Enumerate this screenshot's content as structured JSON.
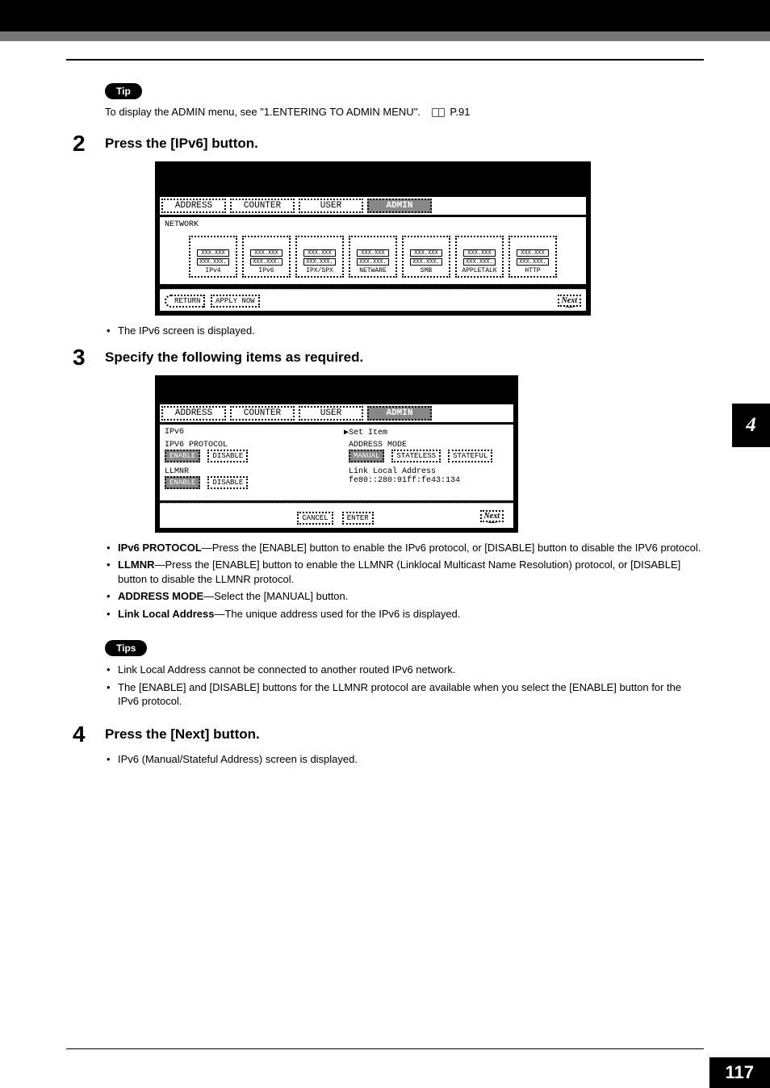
{
  "header": {},
  "tip1": {
    "label": "Tip",
    "text_a": "To display the ADMIN menu, see \"1.ENTERING TO ADMIN MENU\".",
    "page_ref": "P.91"
  },
  "step2": {
    "num": "2",
    "title": "Press the [IPv6] button.",
    "panel": {
      "tabs": [
        "ADDRESS",
        "COUNTER",
        "USER",
        "ADMIN"
      ],
      "active": "ADMIN",
      "heading": "NETWORK",
      "icons": [
        {
          "l1": "XXX.XXX",
          "l2": "XXX.XXX.",
          "label": "IPv4"
        },
        {
          "l1": "XXX.XXX",
          "l2": "XXX.XXX.",
          "label": "IPv6"
        },
        {
          "l1": "XXX.XXX",
          "l2": "XXX.XXX.",
          "label": "IPX/SPX"
        },
        {
          "l1": "XXX.XXX",
          "l2": "XXX.XXX.",
          "label": "NETWARE"
        },
        {
          "l1": "XXX.XXX",
          "l2": "XXX.XXX.",
          "label": "SMB"
        },
        {
          "l1": "XXX.XXX",
          "l2": "XXX.XXX.",
          "label": "APPLETALK"
        },
        {
          "l1": "XXX.XXX",
          "l2": "XXX.XXX.",
          "label": "HTTP"
        }
      ],
      "return": "RETURN",
      "apply": "APPLY NOW",
      "next": "Next"
    },
    "after_bullet": "The IPv6 screen is displayed."
  },
  "step3": {
    "num": "3",
    "title": "Specify the following items as required.",
    "panel": {
      "tabs": [
        "ADDRESS",
        "COUNTER",
        "USER",
        "ADMIN"
      ],
      "active": "ADMIN",
      "row1_left": "IPv6",
      "row1_right": "▶Set Item",
      "left_blocks": {
        "proto_label": "IPV6 PROTOCOL",
        "llmnr_label": "LLMNR",
        "enable": "ENABLE",
        "disable": "DISABLE"
      },
      "right_blocks": {
        "mode_label": "ADDRESS MODE",
        "manual": "MANUAL",
        "stateless": "STATELESS",
        "stateful": "STATEFUL",
        "link_label": "Link Local Address",
        "link_value": "fe80::280:91ff:fe43:134"
      },
      "cancel": "CANCEL",
      "enter": "ENTER",
      "next": "Next"
    },
    "bullets": [
      {
        "b": "IPv6 PROTOCOL",
        "t": "—Press the [ENABLE] button to enable the IPv6 protocol, or [DISABLE] button to disable the IPV6 protocol."
      },
      {
        "b": "LLMNR",
        "t": "—Press the [ENABLE] button to enable the LLMNR (Linklocal Multicast Name Resolution) protocol, or [DISABLE] button to disable the LLMNR protocol."
      },
      {
        "b": "ADDRESS MODE",
        "t": "—Select the [MANUAL] button."
      },
      {
        "b": "Link Local Address",
        "t": "—The unique address used for the IPv6 is displayed."
      }
    ]
  },
  "tips2": {
    "label": "Tips",
    "items": [
      "Link Local Address cannot be connected to another routed IPv6 network.",
      "The [ENABLE] and [DISABLE] buttons for the LLMNR protocol are available when you select the [ENABLE] button for the IPv6 protocol."
    ]
  },
  "step4": {
    "num": "4",
    "title": "Press the [Next] button.",
    "after_bullet": "IPv6 (Manual/Stateful Address) screen is displayed."
  },
  "side_tab": "4",
  "page_number": "117"
}
